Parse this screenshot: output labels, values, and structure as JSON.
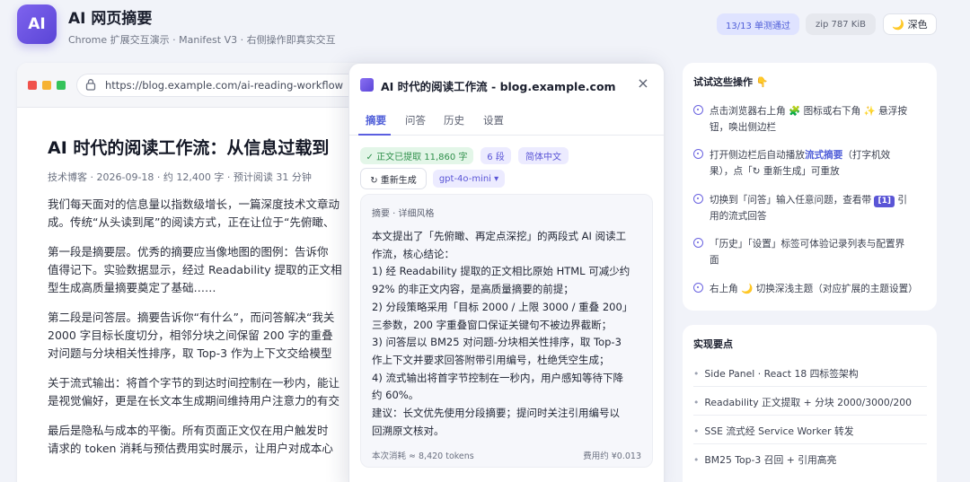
{
  "header": {
    "logo": "AI",
    "title": "AI 网页摘要",
    "subtitle": "Chrome 扩展交互演示 · Manifest V3 · 右侧操作即真实交互",
    "badge_tests": "13/13 单测通过",
    "badge_zip": "zip 787 KiB",
    "theme_button": "🌙 深色"
  },
  "browser": {
    "url": "https://blog.example.com/ai-reading-workflow",
    "article": {
      "title": "AI 时代的阅读工作流：从信息过载到",
      "meta": "技术博客 · 2026-09-18 · 约 12,400 字 · 预计阅读 31 分钟",
      "paragraphs": [
        "我们每天面对的信息量以指数级增长，一篇深度技术文章动\n成。传统“从头读到尾”的阅读方式，正在让位于“先俯瞰、",
        "第一段是摘要层。优秀的摘要应当像地图的图例：告诉你\n值得记下。实验数据显示，经过 Readability 提取的正文相\n型生成高质量摘要奠定了基础……",
        "第二段是问答层。摘要告诉你“有什么”，而问答解决“我关\n2000 字目标长度切分，相邻分块之间保留 200 字的重叠\n对问题与分块相关性排序，取 Top-3 作为上下文交给模型",
        "关于流式输出：将首个字节的到达时间控制在一秒内，能让\n是视觉偏好，更是在长文本生成期间维持用户注意力的有交",
        "最后是隐私与成本的平衡。所有页面正文仅在用户触发时\n请求的 token 消耗与预估费用实时展示，让用户对成本心"
      ]
    }
  },
  "panel": {
    "title": "AI 时代的阅读工作流 - blog.example.com",
    "close_icon": "×",
    "tabs": [
      "摘要",
      "问答",
      "历史",
      "设置"
    ],
    "active_tab": 0,
    "chips": {
      "extracted": "✓ 正文已提取 11,860 字",
      "segments": "6 段",
      "language": "简体中文"
    },
    "regenerate": "↻ 重新生成",
    "model": "gpt-4o-mini ▾",
    "summary": {
      "label": "摘要 · 详细风格",
      "text": "本文提出了「先俯瞰、再定点深挖」的两段式 AI 阅读工\n作流，核心结论：\n1) 经 Readability 提取的正文相比原始 HTML 可减少约\n92% 的非正文内容，是高质量摘要的前提；\n2) 分段策略采用「目标 2000 / 上限 3000 / 重叠 200」\n三参数，200 字重叠窗口保证关键句不被边界截断；\n3) 问答层以 BM25 对问题-分块相关性排序，取 Top-3\n作上下文并要求回答附带引用编号，杜绝凭空生成；\n4) 流式输出将首字节控制在一秒内，用户感知等待下降\n约 60%。\n建议：长文优先使用分段摘要；提问时关注引用编号以\n回溯原文核对。",
      "tokens": "本次消耗 ≈ 8,420 tokens",
      "cost": "费用约 ¥0.013"
    }
  },
  "sidebar": {
    "try_title": "试试这些操作 👇",
    "steps": [
      {
        "pre": "点击浏览器右上角 🧩 图标或右下角 ✨ 悬浮按\n钮，唤出侧边栏",
        "bold": "",
        "post": ""
      },
      {
        "pre": "打开侧边栏后自动播放",
        "bold": "流式摘要",
        "post": "（打字机效\n果），点「↻ 重新生成」可重放"
      },
      {
        "pre": "切换到「问答」输入任意问题，查看带 ",
        "bold": "",
        "post": " 引\n用的流式回答"
      },
      {
        "pre": "「历史」「设置」标签可体验记录列表与配置界\n面",
        "bold": "",
        "post": ""
      },
      {
        "pre": "右上角 🌙 切换深浅主题（对应扩展的主题设置）",
        "bold": "",
        "post": ""
      }
    ],
    "cite_badge": "[1]",
    "points_title": "实现要点",
    "points": [
      "Side Panel · React 18 四标签架构",
      "Readability 正文提取 + 分块 2000/3000/200",
      "SSE 流式经 Service Worker 转发",
      "BM25 Top-3 召回 + 引用高亮"
    ]
  },
  "colors": {
    "accent": "#5b5fe0",
    "background": "#f1f3f9",
    "success": "#2e8f4a",
    "traffic_red": "#f0524c",
    "traffic_yellow": "#f6b233",
    "traffic_green": "#34c35a"
  }
}
